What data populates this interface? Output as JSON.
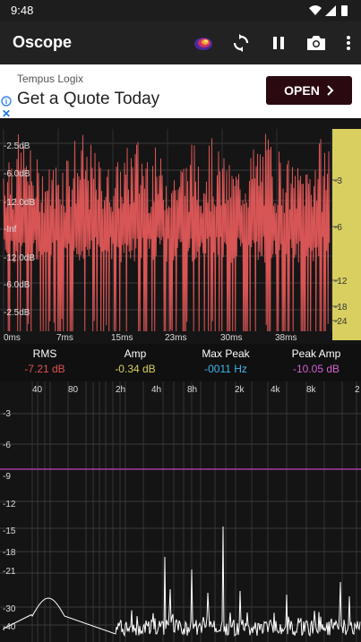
{
  "status": {
    "time": "9:48"
  },
  "app": {
    "title": "Oscope"
  },
  "ad": {
    "sponsor": "Tempus Logix",
    "headline": "Get a Quote Today",
    "cta": "OPEN"
  },
  "scope": {
    "db_labels": [
      "-2.5dB",
      "-6.0dB",
      "-12.0dB",
      "-Inf",
      "-12.0dB",
      "-6.0dB",
      "-2.5dB"
    ],
    "time_labels": [
      "0ms",
      "7ms",
      "15ms",
      "23ms",
      "30ms",
      "38ms"
    ],
    "meter_labels": [
      "-3",
      "-6",
      "-12",
      "-18",
      "-24"
    ],
    "colors": {
      "wave": "#d85555",
      "meter": "#d8cf60"
    }
  },
  "readouts": {
    "rms": {
      "label": "RMS",
      "value": "-7.21 dB",
      "color": "#e05050"
    },
    "amp": {
      "label": "Amp",
      "value": "-0.34 dB",
      "color": "#d8cf60"
    },
    "max_peak": {
      "label": "Max Peak",
      "value": "-0011 Hz",
      "color": "#3fb6e8"
    },
    "peak_amp": {
      "label": "Peak Amp",
      "value": "-10.05 dB",
      "color": "#d060d0"
    }
  },
  "spectrum": {
    "freq_labels": [
      "40",
      "80",
      "2h",
      "4h",
      "8h",
      "2k",
      "4k",
      "8k",
      "2"
    ],
    "db_labels": [
      "-3",
      "-6",
      "-9",
      "-12",
      "-15",
      "-18",
      "-21",
      "-30",
      "-40"
    ],
    "colors": {
      "line": "#ffffff",
      "marker": "#c040c0"
    }
  }
}
